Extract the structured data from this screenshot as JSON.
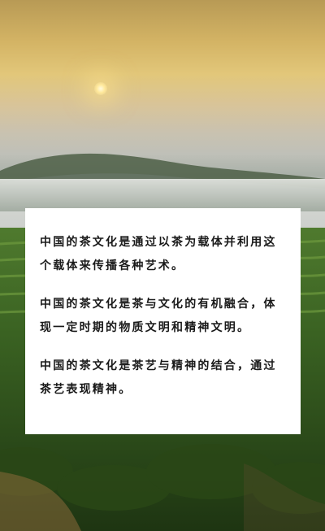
{
  "article": {
    "paragraphs": [
      "中国的茶文化是通过以茶为载体并利用这个载体来传播各种艺术。",
      "中国的茶文化是茶与文化的有机融合，体现一定时期的物质文明和精神文明。",
      "中国的茶文化是茶艺与精神的结合，通过茶艺表现精神。"
    ]
  },
  "colors": {
    "sky_top": "#d4b465",
    "sun": "#ffe89a",
    "mist": "#cfd2cf",
    "tea_green": "#2e4a1e",
    "card_background": "#ffffff",
    "text": "#1a1a1a"
  }
}
